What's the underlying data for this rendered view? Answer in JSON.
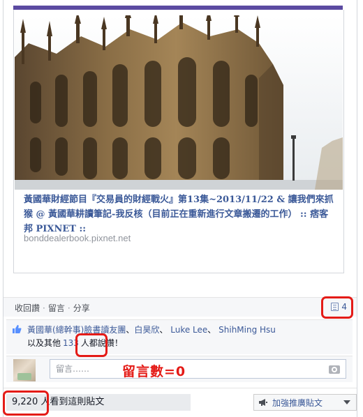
{
  "link": {
    "title": "黃國華財經節目『交易員的財經戰火』第13集~2013/11/22 & 讓我們來抓猴 @ 黃國華耕讀筆記-我反核（目前正在重新進行文章搬遷的工作） :: 痞客邦 PIXNET ::",
    "domain": "bonddealerbook.pixnet.net"
  },
  "actions": {
    "unlike": "收回讚",
    "comment": "留言",
    "share": "分享",
    "separator": "·",
    "share_count": "4"
  },
  "likes": {
    "names": [
      "黃國華(總幹事)臉書讀友團",
      "白昊欣",
      "Luke Lee",
      "ShihMing Hsu"
    ],
    "sep1": "、",
    "sep2": "、",
    "sep3": "、",
    "others_prefix": "以及其他",
    "others_count": "133",
    "others_suffix": "人都說讚！"
  },
  "comment": {
    "placeholder": "留言……"
  },
  "annotation": {
    "text": "留言數=0"
  },
  "footer": {
    "views": "9,220 人看到這則貼文",
    "promote": "加強推廣貼文"
  },
  "colors": {
    "accent": "#3b5998",
    "highlight": "#e41b17"
  }
}
